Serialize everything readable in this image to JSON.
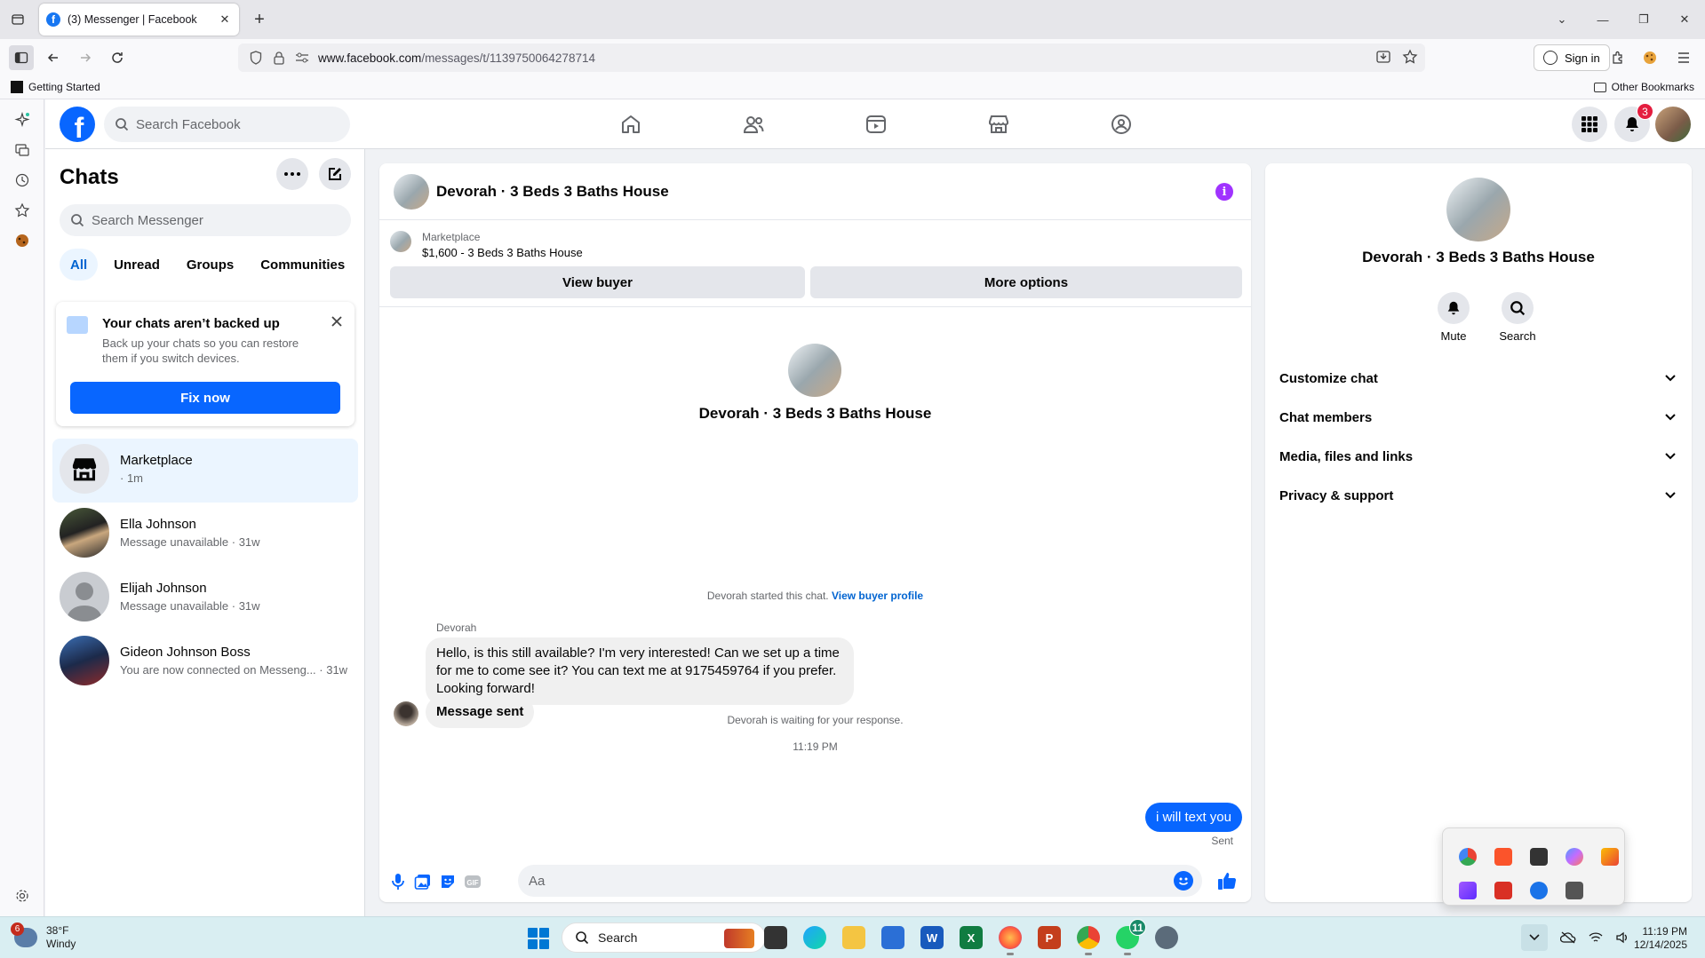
{
  "browser": {
    "tab_title": "(3) Messenger | Facebook",
    "url_domain": "www.facebook.com",
    "url_path": "/messages/t/1139750064278714",
    "sign_in": "Sign in",
    "bookmark_left": "Getting Started",
    "bookmark_right": "Other Bookmarks"
  },
  "fb": {
    "logo": "f",
    "search_placeholder": "Search Facebook",
    "notifications_count": "3",
    "nav_icons": [
      "home-icon",
      "friends-icon",
      "video-icon",
      "marketplace-icon",
      "groups-icon"
    ]
  },
  "chats": {
    "title": "Chats",
    "search_placeholder": "Search Messenger",
    "filters": [
      "All",
      "Unread",
      "Groups",
      "Communities"
    ],
    "backup": {
      "title": "Your chats aren’t backed up",
      "text": "Back up your chats so you can restore them if you switch devices.",
      "button": "Fix now"
    },
    "conversations": [
      {
        "name": "Marketplace",
        "sub": "· 1m"
      },
      {
        "name": "Ella Johnson",
        "sub": "Message unavailable · 31w"
      },
      {
        "name": "Elijah Johnson",
        "sub": "Message unavailable · 31w"
      },
      {
        "name": "Gideon Johnson Boss",
        "sub": "You are now connected on Messeng... · 31w"
      }
    ]
  },
  "conversation": {
    "header_name": "Devorah · 3 Beds 3 Baths House",
    "marketplace_label": "Marketplace",
    "listing": "$1,600 - 3 Beds 3 Baths House",
    "view_buyer": "View buyer",
    "more_options": "More options",
    "intro_name": "Devorah · 3 Beds 3 Baths House",
    "started_text": "Devorah started this chat.",
    "view_buyer_profile": "View buyer profile",
    "sender_name": "Devorah",
    "message_1": "Hello, is this still available? I'm very interested! Can we set up a time for me to come see it? You can text me at 9175459764 if you prefer. Looking forward!",
    "message_2": "Message sent",
    "waiting_text": "Devorah is waiting for your response.",
    "timestamp": "11:19 PM",
    "outgoing": "i will text you",
    "outgoing_status": "Sent",
    "composer_placeholder": "Aa"
  },
  "details": {
    "name": "Devorah · 3 Beds 3 Baths House",
    "actions": [
      "Mute",
      "Search"
    ],
    "sections": [
      "Customize chat",
      "Chat members",
      "Media, files and links",
      "Privacy & support"
    ]
  },
  "taskbar": {
    "weather_badge": "6",
    "temp": "38°F",
    "condition": "Windy",
    "search": "Search",
    "time": "11:19 PM",
    "date": "12/14/2025",
    "whatsapp_badge": "11"
  },
  "colors": {
    "fb_blue": "#0866ff",
    "link_blue": "#0064d1",
    "info_purple": "#a033ff",
    "badge_red": "#e41e3f"
  }
}
